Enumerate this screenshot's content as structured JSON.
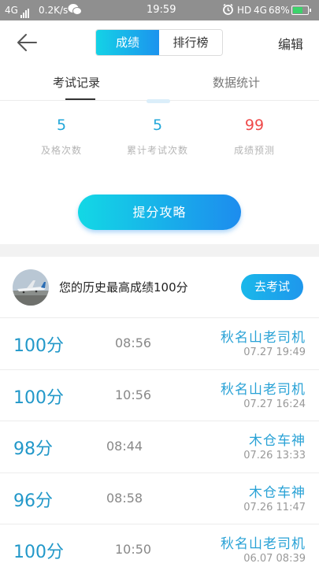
{
  "status_bar": {
    "network": "4G",
    "speed": "0.2K/s",
    "time": "19:59",
    "hd": "HD",
    "network2": "4G",
    "battery_pct": "68%",
    "battery_level": 0.68
  },
  "top_bar": {
    "tabs": [
      "成绩",
      "排行榜"
    ],
    "active_tab": "成绩",
    "edit_label": "编辑"
  },
  "sub_tabs": {
    "tab1": "考试记录",
    "tab2": "数据统计",
    "active": "考试记录"
  },
  "stats": [
    {
      "value": "5",
      "label": "及格次数",
      "color": "#22a7d9"
    },
    {
      "value": "5",
      "label": "累计考试次数",
      "color": "#22a7d9"
    },
    {
      "value": "99",
      "label": "成绩预测",
      "color": "#ef4a4a"
    }
  ],
  "tips_button": "提分攻略",
  "best": {
    "text": "您的历史最高成绩100分",
    "button": "去考试"
  },
  "records": [
    {
      "score": "100分",
      "duration": "08:56",
      "title": "秋名山老司机",
      "datetime": "07.27  19:49"
    },
    {
      "score": "100分",
      "duration": "10:56",
      "title": "秋名山老司机",
      "datetime": "07.27  16:24"
    },
    {
      "score": "98分",
      "duration": "08:44",
      "title": "木仓车神",
      "datetime": "07.26  13:33"
    },
    {
      "score": "96分",
      "duration": "08:58",
      "title": "木仓车神",
      "datetime": "07.26  11:47"
    },
    {
      "score": "100分",
      "duration": "10:50",
      "title": "秋名山老司机",
      "datetime": "06.07  08:39"
    }
  ]
}
